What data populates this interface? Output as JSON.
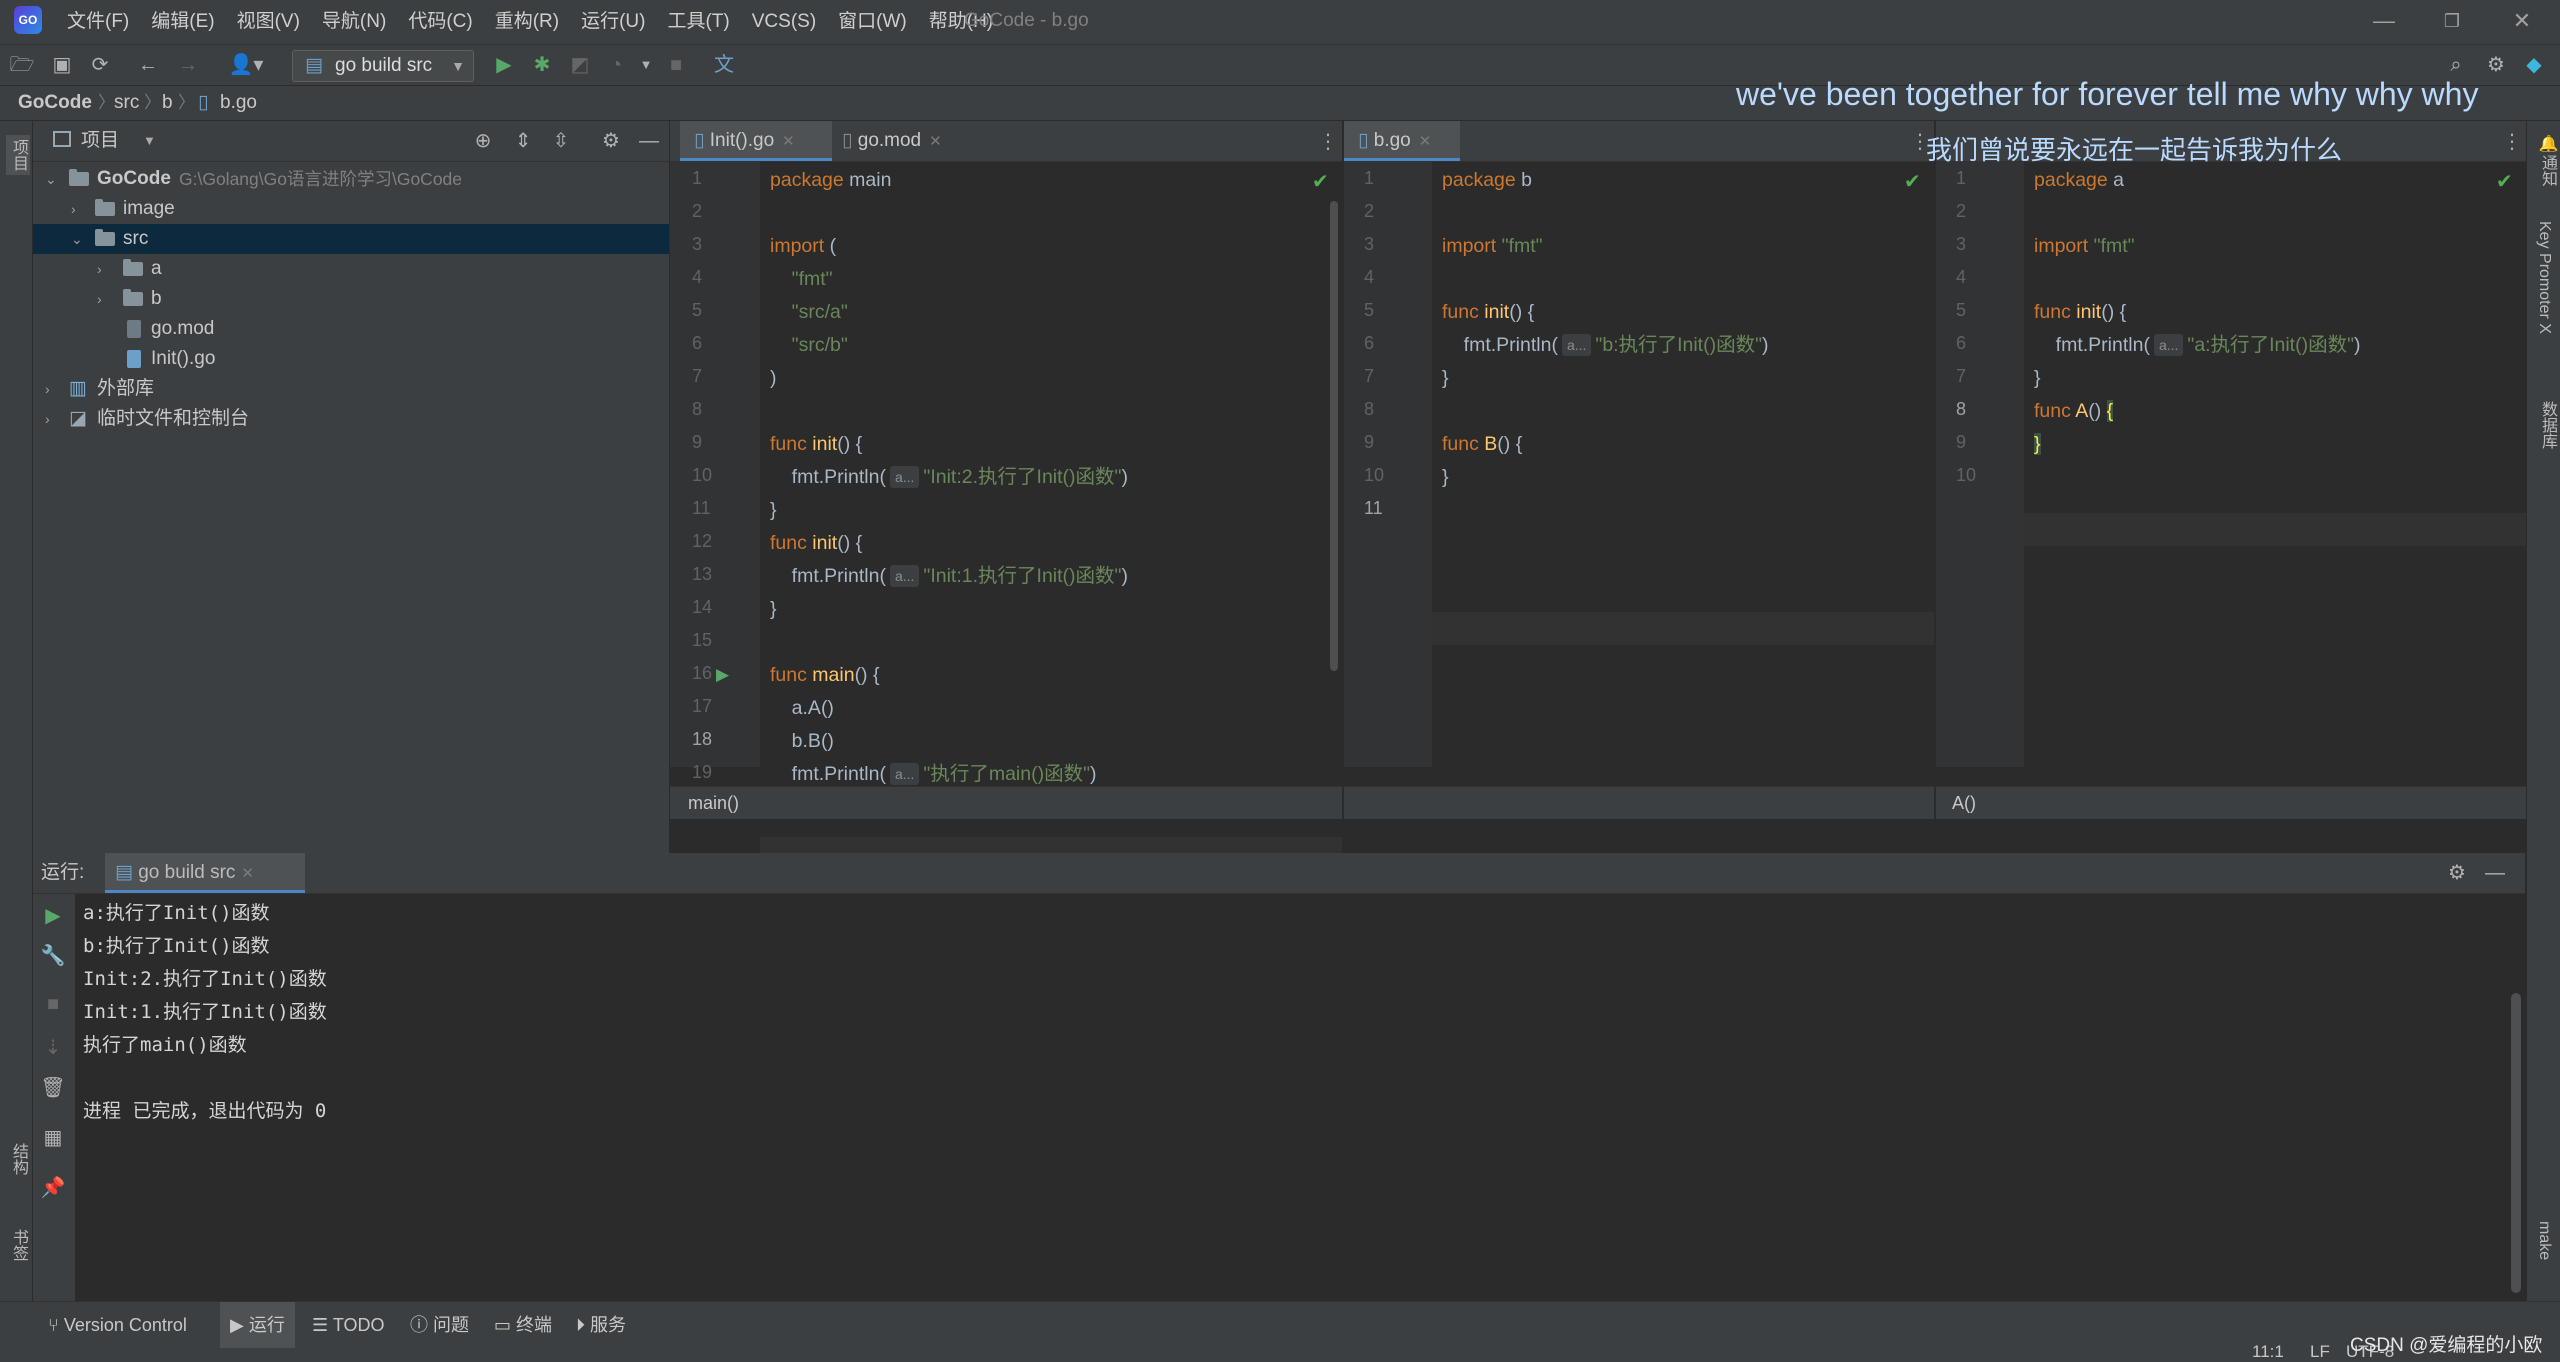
{
  "app": {
    "window_title": "GoCode - b.go",
    "menu": [
      "文件(F)",
      "编辑(E)",
      "视图(V)",
      "导航(N)",
      "代码(C)",
      "重构(R)",
      "运行(U)",
      "工具(T)",
      "VCS(S)",
      "窗口(W)",
      "帮助(H)"
    ]
  },
  "toolbar": {
    "run_config": "go build src"
  },
  "breadcrumb": [
    "GoCode",
    "src",
    "b",
    "b.go"
  ],
  "subtitles": {
    "line1": "we've been together for forever tell me why why why",
    "line2": "我们曾说要永远在一起告诉我为什么"
  },
  "project": {
    "header": "项目",
    "root_name": "GoCode",
    "root_path": "G:\\Golang\\Go语言进阶学习\\GoCode",
    "items": {
      "image": "image",
      "src": "src",
      "a": "a",
      "b": "b",
      "gomod": "go.mod",
      "initgo": "Init().go",
      "external": "外部库",
      "scratch": "临时文件和控制台"
    }
  },
  "side": {
    "left_project": "项目",
    "left_structure": "结构",
    "left_bookmarks": "书签",
    "right_notify": "通知",
    "right_keypromoter": "Key Promoter X",
    "right_database": "数据库",
    "right_make": "make"
  },
  "editor1": {
    "tabs": [
      "Init().go",
      "go.mod"
    ],
    "footer": "main()",
    "lines": {
      "l1a": "package",
      "l1b": "main",
      "l3": "import",
      "l4": "\"fmt\"",
      "l5": "\"src/a\"",
      "l6": "\"src/b\"",
      "fn_kw": "func",
      "init": "init",
      "main": "main",
      "println": "fmt.Println(",
      "hint": "a...",
      "s10": "\"Init:2.执行了Init()函数\"",
      "s13": "\"Init:1.执行了Init()函数\"",
      "s19": "\"执行了main()函数\"",
      "l17": "a.A()",
      "l18": "b.B()"
    }
  },
  "editor2": {
    "tab": "b.go",
    "pkg": "b",
    "s6": "\"b:执行了Init()函数\"",
    "fnB": "B"
  },
  "editor3": {
    "pkg": "a",
    "s6": "\"a:执行了Init()函数\"",
    "fnA": "A",
    "footer": "A()"
  },
  "run": {
    "label": "运行:",
    "tab": "go build src",
    "output": [
      "a:执行了Init()函数",
      "b:执行了Init()函数",
      "Init:2.执行了Init()函数",
      "Init:1.执行了Init()函数",
      "执行了main()函数",
      "",
      "进程 已完成，退出代码为 0"
    ]
  },
  "bottom_tools": [
    "Version Control",
    "运行",
    "TODO",
    "问题",
    "终端",
    "服务"
  ],
  "status": {
    "position": "11:1",
    "line_sep": "LF",
    "encoding": "UTF-8",
    "watermark": "CSDN @爱编程的小欧"
  }
}
